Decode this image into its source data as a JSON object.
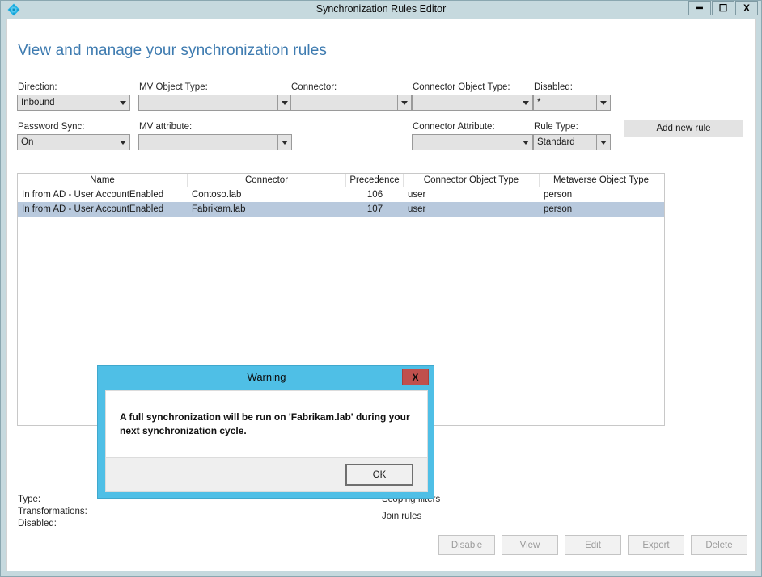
{
  "window": {
    "title": "Synchronization Rules Editor",
    "icon": "azure-ad-connect-diamond-icon",
    "minimize_label": "–",
    "maximize_label": "▭",
    "close_label": "X",
    "titlebar_color": "#c6d9de"
  },
  "page": {
    "title": "View and manage your synchronization rules",
    "title_color": "#3e7bb0"
  },
  "filters": {
    "direction": {
      "label": "Direction:",
      "value": "Inbound"
    },
    "mv_object_type": {
      "label": "MV Object Type:",
      "value": ""
    },
    "connector": {
      "label": "Connector:",
      "value": ""
    },
    "connector_object_type": {
      "label": "Connector Object Type:",
      "value": ""
    },
    "disabled": {
      "label": "Disabled:",
      "value": "*"
    },
    "password_sync": {
      "label": "Password Sync:",
      "value": "On"
    },
    "mv_attribute": {
      "label": "MV attribute:",
      "value": ""
    },
    "connector_attribute": {
      "label": "Connector Attribute:",
      "value": ""
    },
    "rule_type": {
      "label": "Rule Type:",
      "value": "Standard"
    }
  },
  "toolbar": {
    "add_new_rule_label": "Add new rule"
  },
  "rules_table": {
    "columns": [
      "Name",
      "Connector",
      "Precedence",
      "Connector Object Type",
      "Metaverse Object Type"
    ],
    "rows": [
      {
        "name": "In from AD - User AccountEnabled",
        "connector": "Contoso.lab",
        "precedence": "106",
        "connector_object_type": "user",
        "metaverse_object_type": "person",
        "selected": false
      },
      {
        "name": "In from AD - User AccountEnabled",
        "connector": "Fabrikam.lab",
        "precedence": "107",
        "connector_object_type": "user",
        "metaverse_object_type": "person",
        "selected": true
      }
    ],
    "selected_row_color": "#b8c9dd"
  },
  "detail": {
    "left": [
      {
        "label": "Type:",
        "value": ""
      },
      {
        "label": "Transformations:",
        "value": ""
      },
      {
        "label": "Disabled:",
        "value": ""
      }
    ],
    "right": [
      {
        "label": "Scoping filters"
      },
      {
        "label": "Join rules"
      }
    ]
  },
  "actions": {
    "buttons": [
      {
        "label": "Disable",
        "enabled": false
      },
      {
        "label": "View",
        "enabled": false
      },
      {
        "label": "Edit",
        "enabled": false
      },
      {
        "label": "Export",
        "enabled": false
      },
      {
        "label": "Delete",
        "enabled": false
      }
    ]
  },
  "warning_dialog": {
    "title": "Warning",
    "close_label": "X",
    "message": "A full synchronization will be run on 'Fabrikam.lab' during your next synchronization cycle.",
    "ok_label": "OK",
    "accent_color": "#4fbfe6",
    "close_button_color": "#c0504d"
  }
}
